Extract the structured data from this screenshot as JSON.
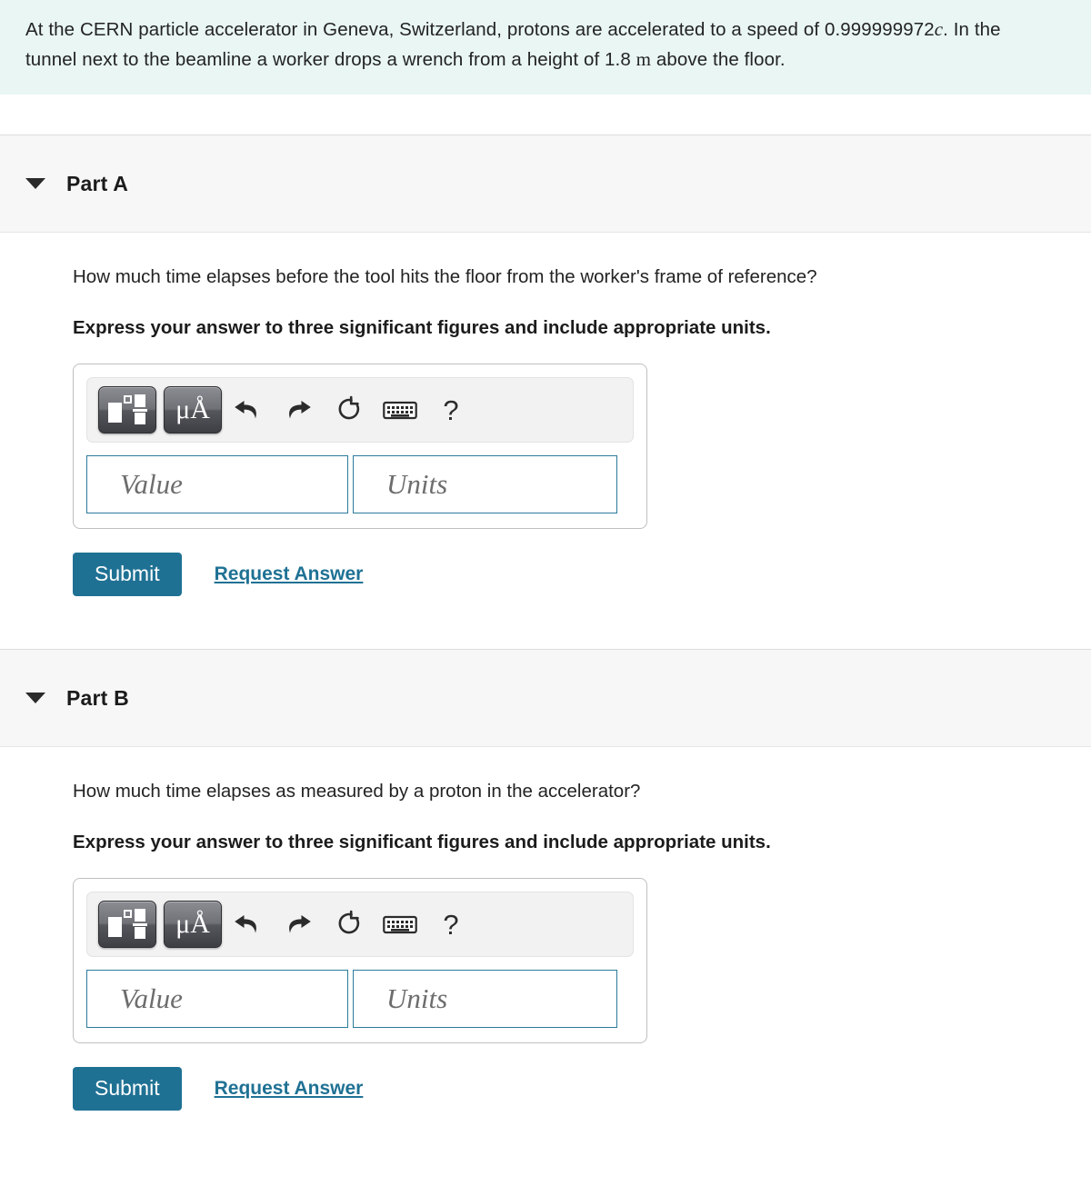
{
  "problem": {
    "text_before_speed": "At the CERN particle accelerator in Geneva, Switzerland, protons are accelerated to a speed of ",
    "speed_value": "0.999999972",
    "speed_symbol": "c",
    "text_middle": ". In the tunnel next to the beamline a worker drops a wrench from a height of 1.8 ",
    "unit_symbol": "m",
    "text_after": " above the floor.",
    "background_color": "#e9f6f4"
  },
  "toolbar": {
    "template_button_label": "math-template",
    "units_button_label": "μÅ",
    "undo_label": "undo",
    "redo_label": "redo",
    "reset_label": "reset",
    "keyboard_label": "keyboard",
    "help_label": "?"
  },
  "fields": {
    "value_placeholder": "Value",
    "units_placeholder": "Units",
    "value_current": "",
    "units_current": ""
  },
  "actions": {
    "submit_label": "Submit",
    "request_answer_label": "Request Answer",
    "submit_color": "#1f7194",
    "link_color": "#1f7194"
  },
  "parts": [
    {
      "title": "Part A",
      "question": "How much time elapses before the tool hits the floor from the worker's frame of reference?",
      "instruction": "Express your answer to three significant figures and include appropriate units.",
      "expanded": true
    },
    {
      "title": "Part B",
      "question": "How much time elapses as measured by a proton in the accelerator?",
      "instruction": "Express your answer to three significant figures and include appropriate units.",
      "expanded": true
    }
  ]
}
